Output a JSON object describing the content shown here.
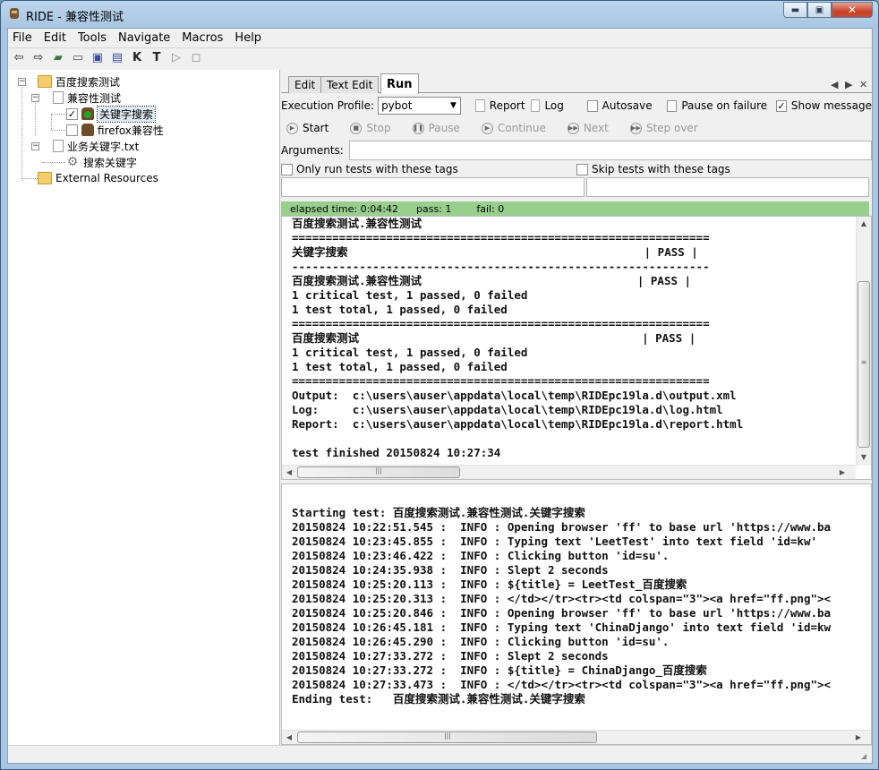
{
  "window": {
    "title": "RIDE - 兼容性测试",
    "min": "▬",
    "max": "▣",
    "close": "✕"
  },
  "menu": [
    "File",
    "Edit",
    "Tools",
    "Navigate",
    "Macros",
    "Help"
  ],
  "toolbar": [
    {
      "name": "back-arrow-icon",
      "glyph": "⇦"
    },
    {
      "name": "forward-arrow-icon",
      "glyph": "⇨"
    },
    {
      "name": "open-directory-icon",
      "glyph": "▰"
    },
    {
      "name": "open-folder-icon",
      "glyph": "▭"
    },
    {
      "name": "save-icon",
      "glyph": "▣"
    },
    {
      "name": "save-all-icon",
      "glyph": "▤"
    },
    {
      "name": "search-keywords-icon",
      "glyph": "K"
    },
    {
      "name": "search-tests-icon",
      "glyph": "T"
    },
    {
      "name": "run-icon",
      "glyph": "▷"
    },
    {
      "name": "stop-icon",
      "glyph": "◻"
    }
  ],
  "tree": {
    "root": "百度搜索测试",
    "suite": "兼容性测试",
    "test1": "关键字搜索",
    "test2": "firefox兼容性",
    "resource": "业务关键字.txt",
    "keyword": "搜索关键字",
    "external": "External Resources"
  },
  "tabs": [
    "Edit",
    "Text Edit",
    "Run"
  ],
  "tab_controls": {
    "left": "◀",
    "right": "▶",
    "close": "✕"
  },
  "run": {
    "profile_label": "Execution Profile:",
    "profile_value": "pybot",
    "report": "Report",
    "log": "Log",
    "autosave": "Autosave",
    "pause_on_failure": "Pause on failure",
    "show_message": "Show message",
    "checkmark": "✓",
    "dropdown_arrow": "▼"
  },
  "controls": {
    "start": "Start",
    "stop": "Stop",
    "pause": "Pause",
    "continue": "Continue",
    "next": "Next",
    "step_over": "Step over",
    "start_glyph": "▶",
    "stop_glyph": "■",
    "pause_glyph": "❚❚",
    "continue_glyph": "▶",
    "next_glyph": "▶▶",
    "step_glyph": "▶▶"
  },
  "arguments_label": "Arguments:",
  "tags": {
    "only_run": "Only run tests with these tags",
    "skip": "Skip tests with these tags"
  },
  "status": {
    "elapsed": "elapsed time: 0:04:42",
    "pass": "pass: 1",
    "fail": "fail: 0"
  },
  "console_top": [
    "百度搜索测试.兼容性测试",
    "==============================================================",
    "关键字搜索                                            | PASS |",
    "--------------------------------------------------------------",
    "百度搜索测试.兼容性测试                                | PASS |",
    "1 critical test, 1 passed, 0 failed",
    "1 test total, 1 passed, 0 failed",
    "==============================================================",
    "百度搜索测试                                          | PASS |",
    "1 critical test, 1 passed, 0 failed",
    "1 test total, 1 passed, 0 failed",
    "==============================================================",
    "Output:  c:\\users\\auser\\appdata\\local\\temp\\RIDEpc19la.d\\output.xml",
    "Log:     c:\\users\\auser\\appdata\\local\\temp\\RIDEpc19la.d\\log.html",
    "Report:  c:\\users\\auser\\appdata\\local\\temp\\RIDEpc19la.d\\report.html",
    "",
    "test finished 20150824 10:27:34"
  ],
  "console_bottom": [
    "",
    "Starting test: 百度搜索测试.兼容性测试.关键字搜索",
    "20150824 10:22:51.545 :  INFO : Opening browser 'ff' to base url 'https://www.ba",
    "20150824 10:23:45.855 :  INFO : Typing text 'LeetTest' into text field 'id=kw'",
    "20150824 10:23:46.422 :  INFO : Clicking button 'id=su'.",
    "20150824 10:24:35.938 :  INFO : Slept 2 seconds",
    "20150824 10:25:20.113 :  INFO : ${title} = LeetTest_百度搜索",
    "20150824 10:25:20.313 :  INFO : </td></tr><tr><td colspan=\"3\"><a href=\"ff.png\"><",
    "20150824 10:25:20.846 :  INFO : Opening browser 'ff' to base url 'https://www.ba",
    "20150824 10:26:45.181 :  INFO : Typing text 'ChinaDjango' into text field 'id=kw",
    "20150824 10:26:45.290 :  INFO : Clicking button 'id=su'.",
    "20150824 10:27:33.272 :  INFO : Slept 2 seconds",
    "20150824 10:27:33.272 :  INFO : ${title} = ChinaDjango_百度搜索",
    "20150824 10:27:33.473 :  INFO : </td></tr><tr><td colspan=\"3\"><a href=\"ff.png\"><",
    "Ending test:   百度搜索测试.兼容性测试.关键字搜索"
  ],
  "scroll": {
    "up": "▲",
    "down": "▼",
    "left": "◀",
    "right": "▶",
    "grip": "≡",
    "hgrip": "|||"
  },
  "tree_expanders": {
    "minus": "−"
  }
}
